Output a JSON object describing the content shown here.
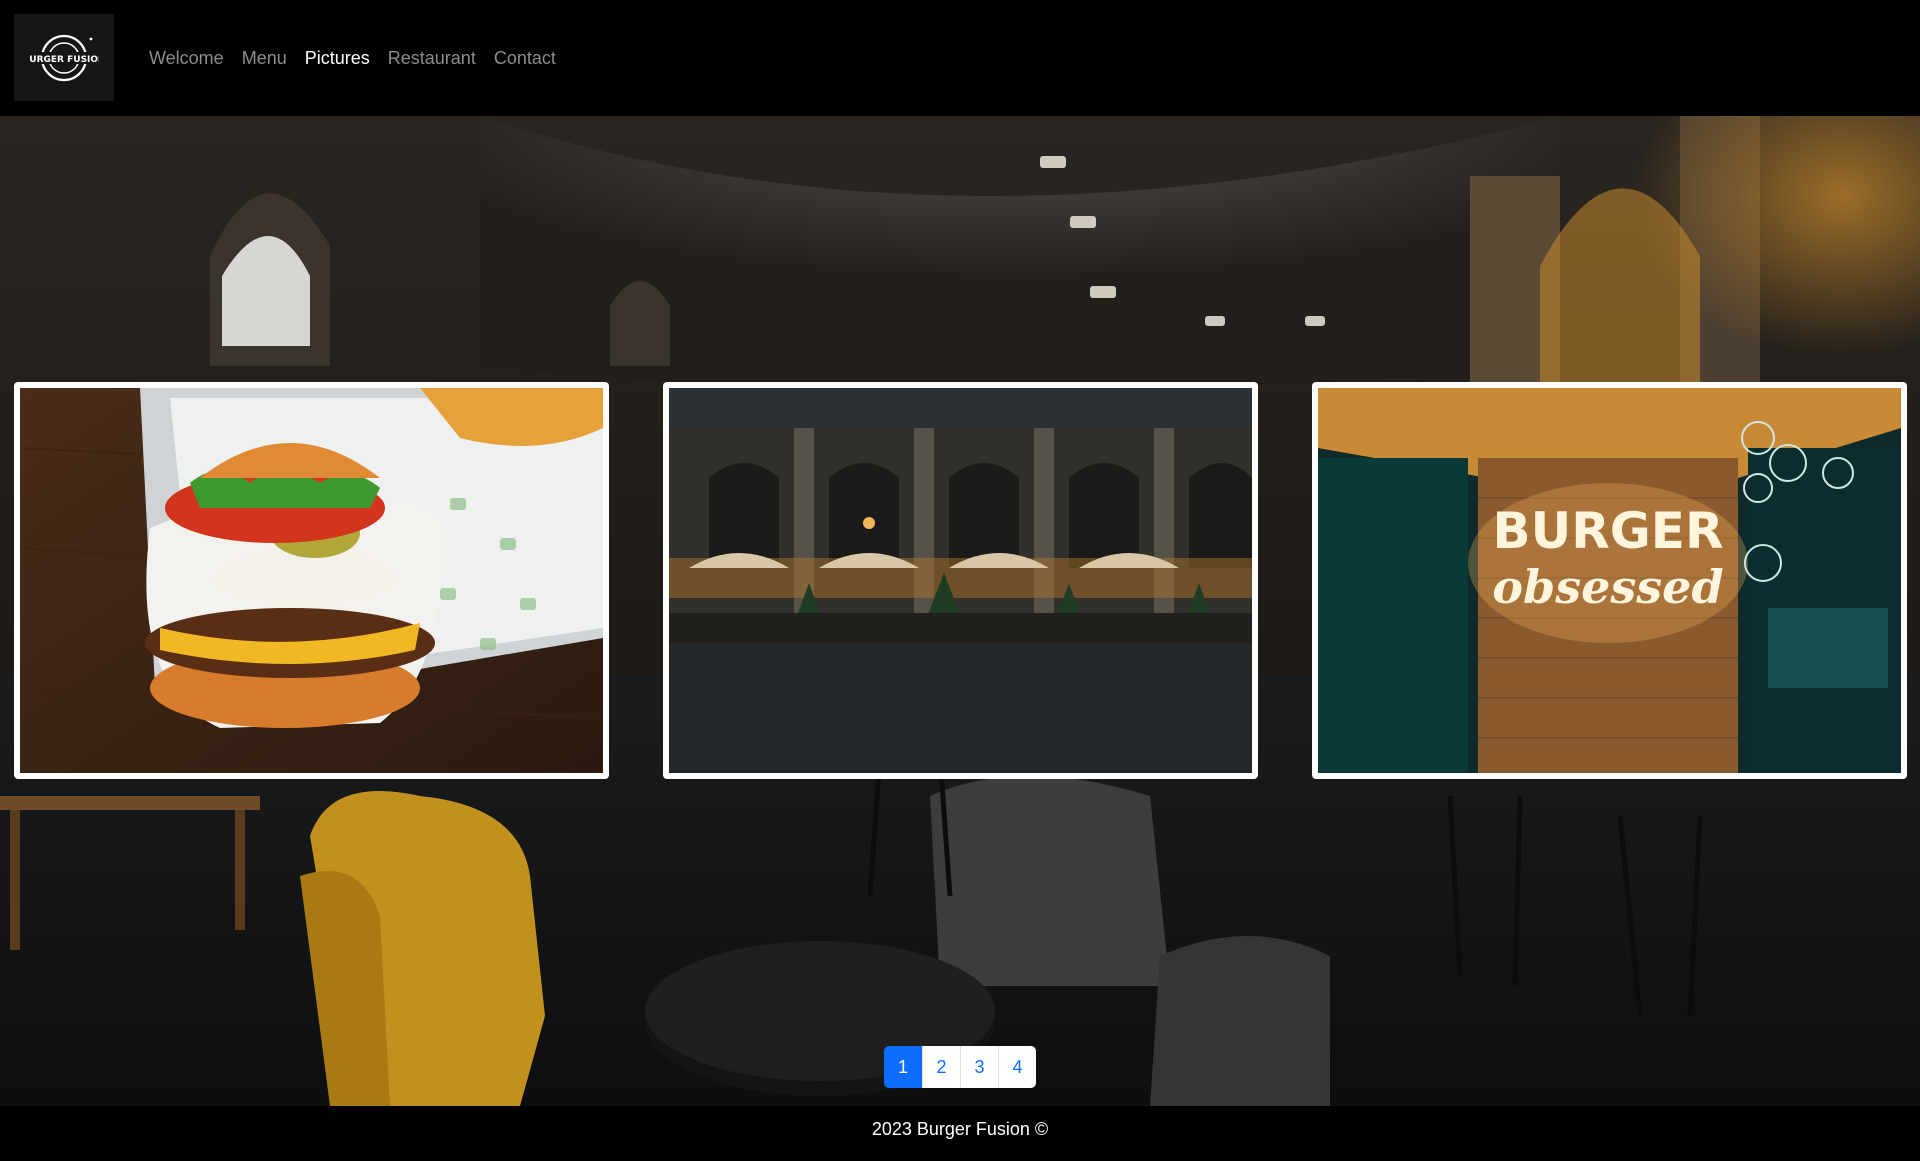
{
  "brand": {
    "logo_text": "BURGER FUSION",
    "logo_icon": "burger-fusion-logo"
  },
  "nav": {
    "items": [
      {
        "label": "Welcome",
        "active": false
      },
      {
        "label": "Menu",
        "active": false
      },
      {
        "label": "Pictures",
        "active": true
      },
      {
        "label": "Restaurant",
        "active": false
      },
      {
        "label": "Contact",
        "active": false
      }
    ]
  },
  "hero": {
    "background": "restaurant-interior-photo"
  },
  "gallery": {
    "cards": [
      {
        "image": "cheeseburger-photo"
      },
      {
        "image": "outdoor-terrace-photo"
      },
      {
        "image": "neon-sign-photo",
        "neon_line1": "BURGER",
        "neon_line2": "obsessed"
      }
    ]
  },
  "pagination": {
    "pages": [
      "1",
      "2",
      "3",
      "4"
    ],
    "current": "1"
  },
  "footer": {
    "text": "2023 Burger Fusion ©"
  },
  "colors": {
    "primary": "#0d6efd",
    "nav_bg": "#000000",
    "nav_inactive": "#8c8c8c",
    "nav_active": "#ffffff"
  }
}
